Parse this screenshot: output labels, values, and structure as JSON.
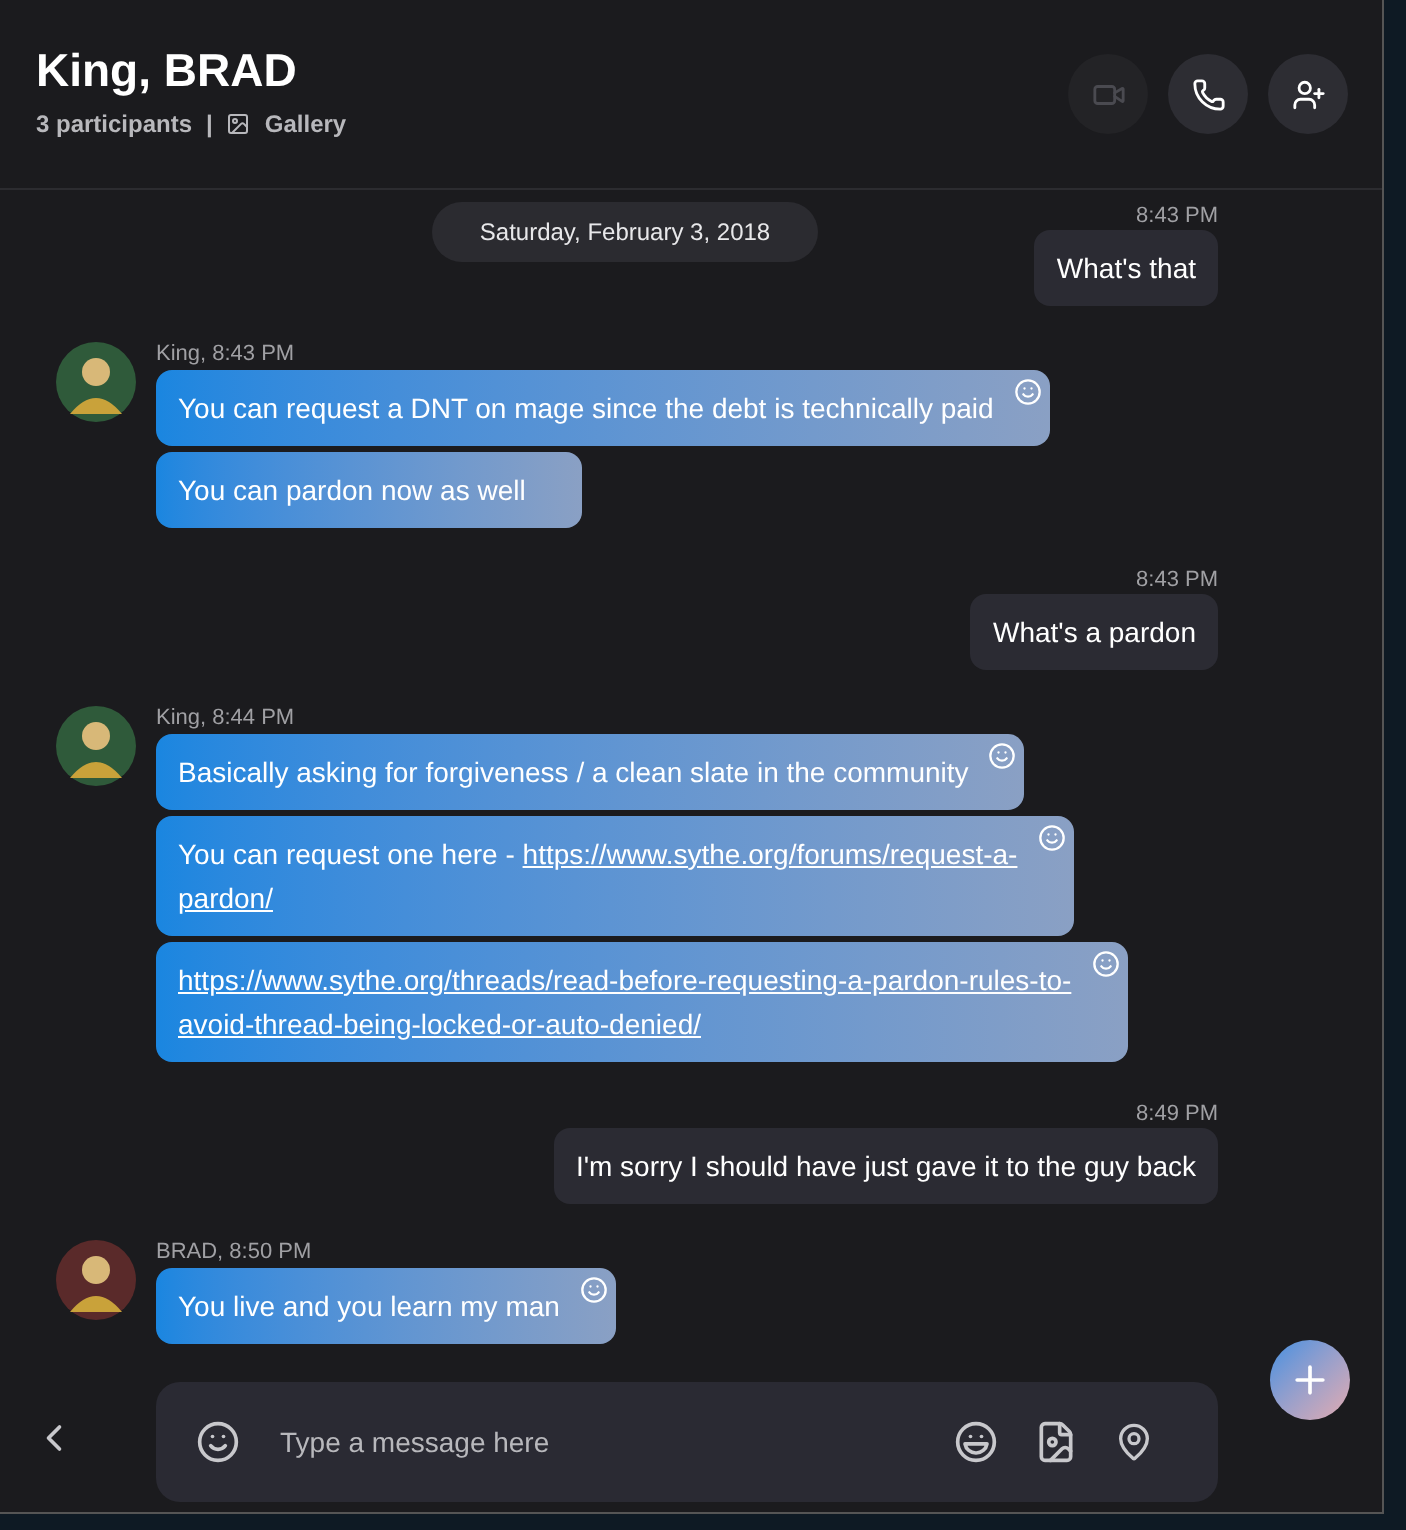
{
  "header": {
    "title": "King, BRAD",
    "participants": "3 participants",
    "separator": "|",
    "gallery": "Gallery",
    "buttons": [
      {
        "kind": "video",
        "disabled": true
      },
      {
        "kind": "call",
        "disabled": false
      },
      {
        "kind": "add-person",
        "disabled": false
      }
    ]
  },
  "messages": [
    {
      "kind": "date",
      "text": "Saturday, February 3, 2018"
    },
    {
      "kind": "outgoing",
      "time": "8:43 PM",
      "text": "What's that"
    },
    {
      "kind": "incoming",
      "color": "#2f5a3a",
      "sender": "King, 8:43 PM",
      "bubbles": [
        {
          "text": "You can request a DNT on mage since the debt is technically paid",
          "reaction": true
        },
        {
          "text": "You can pardon now as well",
          "reaction": false
        }
      ]
    },
    {
      "kind": "outgoing",
      "time": "8:43 PM",
      "text": "What's a pardon"
    },
    {
      "kind": "incoming",
      "color": "#2f5a3a",
      "sender": "King, 8:44 PM",
      "bubbles": [
        {
          "text": "Basically asking for forgiveness / a clean slate in the community",
          "reaction": true
        },
        {
          "text": "You can request one here - ",
          "link_lines": [
            "https://www.sythe.org/forums/request-a-",
            "pardon/"
          ],
          "reaction": true
        },
        {
          "link_lines": [
            "https://www.sythe.org/threads/read-before-requesting-a-pardon-rules-to-",
            "avoid-thread-being-locked-or-auto-denied/"
          ],
          "reaction": true
        }
      ]
    },
    {
      "kind": "outgoing",
      "time": "8:49 PM",
      "text": "I'm sorry I should have just gave it to the guy back"
    },
    {
      "kind": "incoming",
      "color": "#5a2a2a",
      "sender": "BRAD, 8:50 PM",
      "bubbles": [
        {
          "text": "You live and you learn my man",
          "reaction": true
        }
      ]
    }
  ],
  "composer": {
    "placeholder": "Type a message here"
  }
}
